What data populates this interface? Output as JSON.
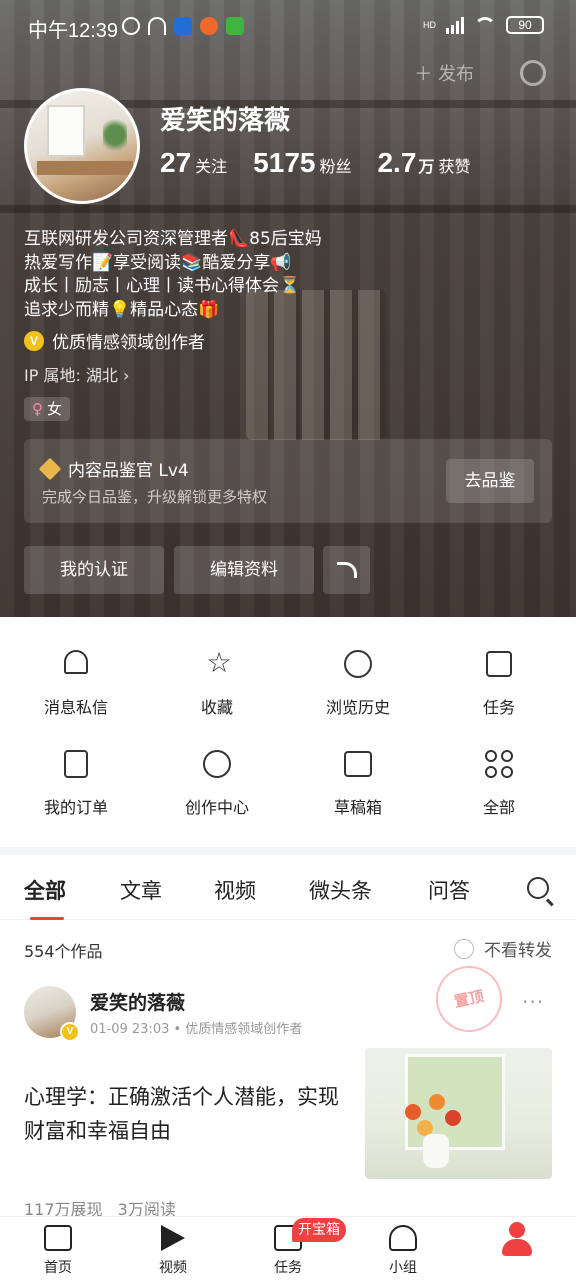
{
  "status_bar": {
    "time": "中午12:39",
    "battery": "90",
    "network": "HD"
  },
  "header": {
    "publish_label": "发布",
    "username": "爱笑的落薇",
    "stats": [
      {
        "num": "27",
        "unit": "",
        "label": "关注"
      },
      {
        "num": "5175",
        "unit": "",
        "label": "粉丝"
      },
      {
        "num": "2.7",
        "unit": "万",
        "label": "获赞"
      }
    ],
    "bio": [
      "互联网研发公司资深管理者👠85后宝妈",
      "热爱写作📝享受阅读📚酷爱分享📢",
      "成长丨励志丨心理丨读书心得体会⏳",
      "追求少而精💡精品心态🎁"
    ],
    "certification": "优质情感领域创作者",
    "ip_location": "IP 属地: 湖北 ›",
    "gender": "女",
    "gender_symbol": "♀",
    "level_card": {
      "title": "内容品鉴官 Lv4",
      "subtitle": "完成今日品鉴，升级解锁更多特权",
      "button": "去品鉴"
    },
    "buttons": {
      "cert": "我的认证",
      "edit": "编辑资料"
    }
  },
  "menu": [
    {
      "label": "消息私信",
      "icon": "bell-icon"
    },
    {
      "label": "收藏",
      "icon": "star-icon"
    },
    {
      "label": "浏览历史",
      "icon": "clock-icon"
    },
    {
      "label": "任务",
      "icon": "calendar-check-icon"
    },
    {
      "label": "我的订单",
      "icon": "order-icon"
    },
    {
      "label": "创作中心",
      "icon": "bulb-icon"
    },
    {
      "label": "草稿箱",
      "icon": "draft-box-icon"
    },
    {
      "label": "全部",
      "icon": "grid-icon"
    }
  ],
  "tabs": [
    "全部",
    "文章",
    "视频",
    "微头条",
    "问答"
  ],
  "works": {
    "count": "554个作品",
    "no_repost": "不看转发"
  },
  "post": {
    "author": "爱笑的落薇",
    "meta": "01-09 23:03 • 优质情感领域创作者",
    "pin": "置顶",
    "title": "心理学：正确激活个人潜能，实现财富和幸福自由",
    "views": "117万展现",
    "reads": "3万阅读"
  },
  "bottom_nav": [
    {
      "label": "首页"
    },
    {
      "label": "视频"
    },
    {
      "label": "任务"
    },
    {
      "label": "小组"
    }
  ],
  "nav_badge": "开宝箱",
  "colors": {
    "accent": "#f04142",
    "verified": "#f2c21b"
  }
}
